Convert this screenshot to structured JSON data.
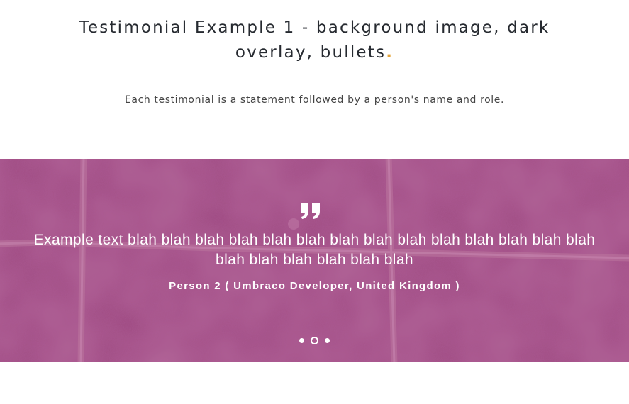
{
  "header": {
    "title_text": "Testimonial Example 1 - background image, dark overlay, bullets",
    "title_accent": ".",
    "subtitle": "Each testimonial is a statement followed by a person's name and role."
  },
  "testimonial": {
    "quote": "Example text blah blah blah blah blah blah blah blah blah blah blah blah blah blah blah blah blah blah blah blah",
    "attribution": "Person 2 ( Umbraco Developer, United Kingdom )",
    "quote_icon": "quote-icon"
  },
  "carousel": {
    "slide_count": 3,
    "active_index": 1
  },
  "colors": {
    "accent": "#e5a43a",
    "hero_background": "#a24a83",
    "text_dark": "#262a30"
  }
}
